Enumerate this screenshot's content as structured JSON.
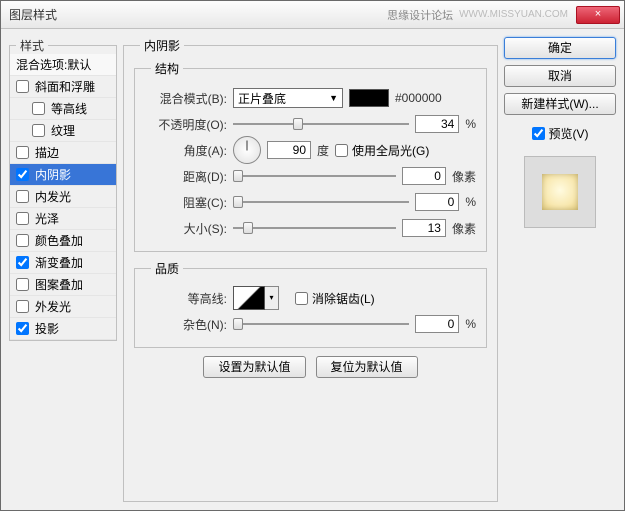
{
  "window": {
    "title": "图层样式",
    "watermark": "思缘设计论坛",
    "url": "WWW.MISSYUAN.COM",
    "close": "×"
  },
  "left": {
    "legend": "样式",
    "header": "混合选项:默认",
    "items": [
      {
        "label": "斜面和浮雕",
        "checked": false
      },
      {
        "label": "等高线",
        "checked": false,
        "indent": true
      },
      {
        "label": "纹理",
        "checked": false,
        "indent": true
      },
      {
        "label": "描边",
        "checked": false
      },
      {
        "label": "内阴影",
        "checked": true,
        "selected": true
      },
      {
        "label": "内发光",
        "checked": false
      },
      {
        "label": "光泽",
        "checked": false
      },
      {
        "label": "颜色叠加",
        "checked": false
      },
      {
        "label": "渐变叠加",
        "checked": true
      },
      {
        "label": "图案叠加",
        "checked": false
      },
      {
        "label": "外发光",
        "checked": false
      },
      {
        "label": "投影",
        "checked": true
      }
    ]
  },
  "panel": {
    "legend": "内阴影",
    "structure": {
      "legend": "结构",
      "blend_label": "混合模式(B):",
      "blend_value": "正片叠底",
      "hex": "#000000",
      "opacity_label": "不透明度(O):",
      "opacity_value": "34",
      "opacity_unit": "%",
      "angle_label": "角度(A):",
      "angle_value": "90",
      "angle_unit": "度",
      "global_label": "使用全局光(G)",
      "distance_label": "距离(D):",
      "distance_value": "0",
      "distance_unit": "像素",
      "choke_label": "阻塞(C):",
      "choke_value": "0",
      "choke_unit": "%",
      "size_label": "大小(S):",
      "size_value": "13",
      "size_unit": "像素"
    },
    "quality": {
      "legend": "品质",
      "contour_label": "等高线:",
      "aa_label": "消除锯齿(L)",
      "noise_label": "杂色(N):",
      "noise_value": "0",
      "noise_unit": "%"
    },
    "btn_default": "设置为默认值",
    "btn_reset": "复位为默认值"
  },
  "right": {
    "ok": "确定",
    "cancel": "取消",
    "newstyle": "新建样式(W)...",
    "preview_label": "预览(V)"
  }
}
